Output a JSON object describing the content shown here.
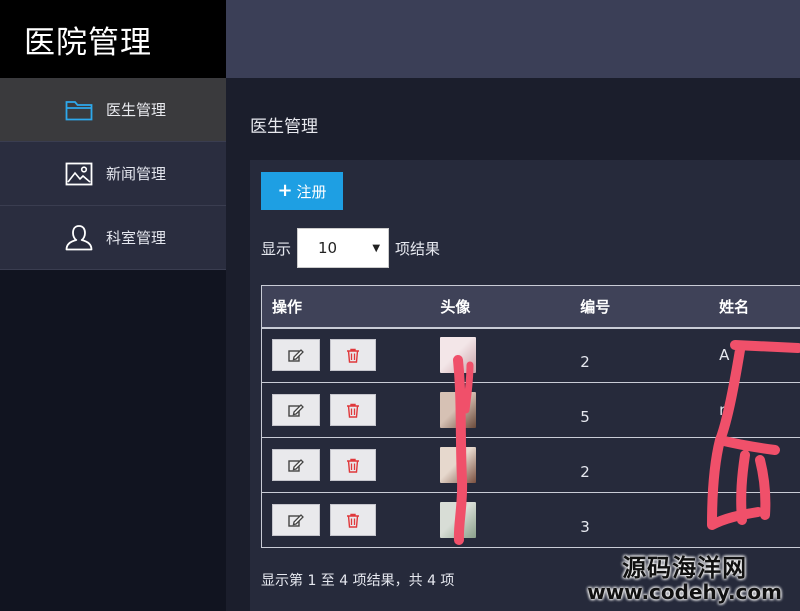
{
  "app": {
    "title": "医院管理"
  },
  "sidebar": {
    "items": [
      {
        "label": "医生管理",
        "icon": "folder-icon",
        "active": true
      },
      {
        "label": "新闻管理",
        "icon": "image-icon",
        "active": false
      },
      {
        "label": "科室管理",
        "icon": "user-icon",
        "active": false
      }
    ]
  },
  "main": {
    "title": "医生管理",
    "register_label": "注册",
    "length": {
      "prefix": "显示",
      "value": "10",
      "suffix": "项结果"
    },
    "table": {
      "headers": [
        "操作",
        "头像",
        "编号",
        "姓名"
      ],
      "rows": [
        {
          "id": "2",
          "name": "A"
        },
        {
          "id": "5",
          "name": "n"
        },
        {
          "id": "2",
          "name": ""
        },
        {
          "id": "3",
          "name": ""
        }
      ]
    },
    "info": "显示第 1 至 4 项结果，共 4 项"
  },
  "watermark": {
    "line1": "源码海洋网",
    "line2": "www.codehy.com"
  },
  "colors": {
    "accent": "#1e9fe3",
    "delete": "#e0383b",
    "scribble": "#f0506a"
  }
}
